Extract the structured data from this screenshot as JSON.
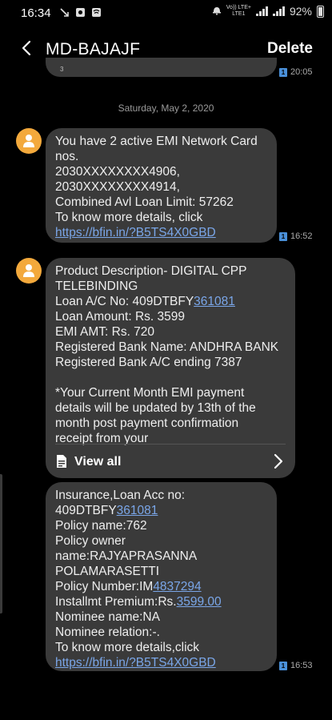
{
  "status": {
    "time": "16:34",
    "volte": "Vo)) LTE+",
    "lte": "LTE1",
    "battery": "92%"
  },
  "header": {
    "title": "MD-BAJAJF",
    "delete_label": "Delete"
  },
  "previous_message": {
    "sim": "1",
    "time": "20:05"
  },
  "date_divider": "Saturday, May 2, 2020",
  "messages": [
    {
      "lines": [
        "You have 2 active EMI Network Card",
        "nos.",
        "2030XXXXXXXX4906,",
        "2030XXXXXXXX4914,",
        "Combined Avl Loan Limit: 57262",
        "To know more details, click"
      ],
      "link": "https://bfin.in/?B5TS4X0GBD",
      "sim": "1",
      "time": "16:52"
    },
    {
      "line1": "Product Description- DIGITAL CPP",
      "line2": "TELEBINDING",
      "loan_ac_prefix": "Loan A/C No: 409DTBFY",
      "loan_ac_link": "361081",
      "line4": "Loan Amount: Rs. 3599",
      "line5": "EMI AMT: Rs. 720",
      "line6": "Registered Bank Name: ANDHRA BANK",
      "line7": "Registered Bank A/C ending 7387",
      "line9": "*Your Current Month EMI payment",
      "line10": "details will be updated by 13th of the",
      "line11": "month post payment confirmation",
      "line12": "receipt from your",
      "view_all_label": "View all"
    },
    {
      "line1": "Insurance,Loan Acc no:",
      "loan_prefix": "409DTBFY",
      "loan_link": "361081",
      "line3": "Policy name:762",
      "line4": "Policy owner",
      "line5": "name:RAJYAPRASANNA",
      "line6": "POLAMARASETTI",
      "policy_prefix": "Policy Number:IM",
      "policy_link": "4837294",
      "premium_prefix": "Installmt Premium:Rs.",
      "premium_link": "3599.00",
      "line9": "Nominee name:NA",
      "line10": "Nominee relation:-.",
      "line11": "To know more details,click",
      "link": "https://bfin.in/?B5TS4X0GBD",
      "sim": "1",
      "time": "16:53"
    }
  ],
  "icons": {
    "back": "arrow-left-icon",
    "avatar": "person-icon",
    "view_all": "document-icon",
    "chevron": "chevron-right-icon"
  },
  "colors": {
    "background": "#000000",
    "bubble": "#3a3a3a",
    "link": "#7aa6e8",
    "avatar": "#f3a93c",
    "sim_badge": "#4a90d9"
  }
}
